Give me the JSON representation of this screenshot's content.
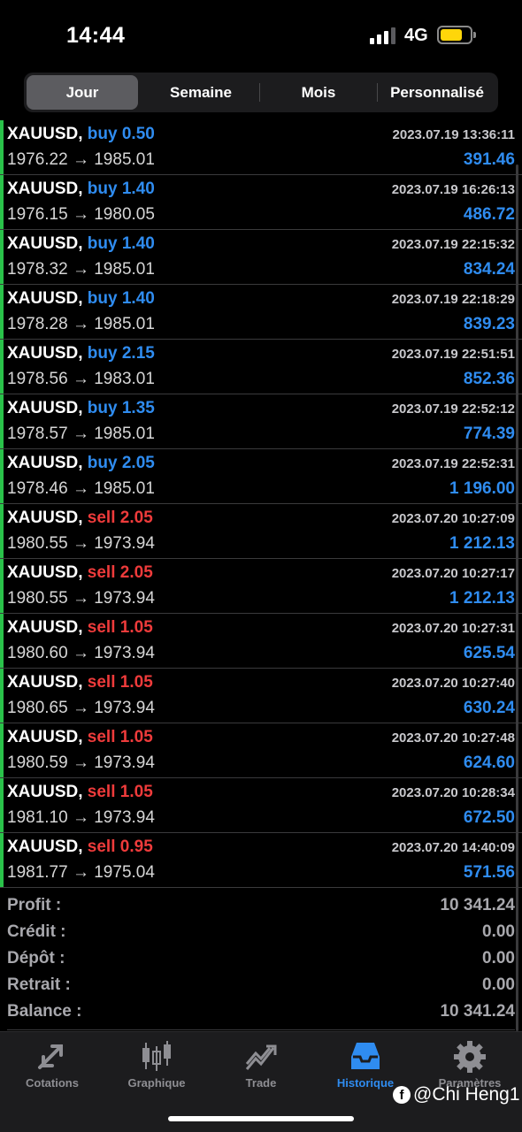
{
  "status_bar": {
    "time": "14:44",
    "network": "4G"
  },
  "periods": [
    {
      "label": "Jour",
      "active": true
    },
    {
      "label": "Semaine",
      "active": false
    },
    {
      "label": "Mois",
      "active": false
    },
    {
      "label": "Personnalisé",
      "active": false
    }
  ],
  "trades": [
    {
      "symbol": "XAUUSD,",
      "side": "buy",
      "volume": "0.50",
      "datetime": "2023.07.19 13:36:11",
      "prices": "1976.22 → 1985.01",
      "profit": "391.46"
    },
    {
      "symbol": "XAUUSD,",
      "side": "buy",
      "volume": "1.40",
      "datetime": "2023.07.19 16:26:13",
      "prices": "1976.15 → 1980.05",
      "profit": "486.72"
    },
    {
      "symbol": "XAUUSD,",
      "side": "buy",
      "volume": "1.40",
      "datetime": "2023.07.19 22:15:32",
      "prices": "1978.32 → 1985.01",
      "profit": "834.24"
    },
    {
      "symbol": "XAUUSD,",
      "side": "buy",
      "volume": "1.40",
      "datetime": "2023.07.19 22:18:29",
      "prices": "1978.28 → 1985.01",
      "profit": "839.23"
    },
    {
      "symbol": "XAUUSD,",
      "side": "buy",
      "volume": "2.15",
      "datetime": "2023.07.19 22:51:51",
      "prices": "1978.56 → 1983.01",
      "profit": "852.36"
    },
    {
      "symbol": "XAUUSD,",
      "side": "buy",
      "volume": "1.35",
      "datetime": "2023.07.19 22:52:12",
      "prices": "1978.57 → 1985.01",
      "profit": "774.39"
    },
    {
      "symbol": "XAUUSD,",
      "side": "buy",
      "volume": "2.05",
      "datetime": "2023.07.19 22:52:31",
      "prices": "1978.46 → 1985.01",
      "profit": "1 196.00"
    },
    {
      "symbol": "XAUUSD,",
      "side": "sell",
      "volume": "2.05",
      "datetime": "2023.07.20 10:27:09",
      "prices": "1980.55 → 1973.94",
      "profit": "1 212.13"
    },
    {
      "symbol": "XAUUSD,",
      "side": "sell",
      "volume": "2.05",
      "datetime": "2023.07.20 10:27:17",
      "prices": "1980.55 → 1973.94",
      "profit": "1 212.13"
    },
    {
      "symbol": "XAUUSD,",
      "side": "sell",
      "volume": "1.05",
      "datetime": "2023.07.20 10:27:31",
      "prices": "1980.60 → 1973.94",
      "profit": "625.54"
    },
    {
      "symbol": "XAUUSD,",
      "side": "sell",
      "volume": "1.05",
      "datetime": "2023.07.20 10:27:40",
      "prices": "1980.65 → 1973.94",
      "profit": "630.24"
    },
    {
      "symbol": "XAUUSD,",
      "side": "sell",
      "volume": "1.05",
      "datetime": "2023.07.20 10:27:48",
      "prices": "1980.59 → 1973.94",
      "profit": "624.60"
    },
    {
      "symbol": "XAUUSD,",
      "side": "sell",
      "volume": "1.05",
      "datetime": "2023.07.20 10:28:34",
      "prices": "1981.10 → 1973.94",
      "profit": "672.50"
    },
    {
      "symbol": "XAUUSD,",
      "side": "sell",
      "volume": "0.95",
      "datetime": "2023.07.20 14:40:09",
      "prices": "1981.77 → 1975.04",
      "profit": "571.56"
    }
  ],
  "summary": [
    {
      "label": "Profit :",
      "value": "10 341.24"
    },
    {
      "label": "Crédit :",
      "value": "0.00"
    },
    {
      "label": "Dépôt :",
      "value": "0.00"
    },
    {
      "label": "Retrait :",
      "value": "0.00"
    },
    {
      "label": "Balance :",
      "value": "10 341.24"
    }
  ],
  "tabs": [
    {
      "label": "Cotations",
      "icon": "quotes-arrows-icon",
      "active": false
    },
    {
      "label": "Graphique",
      "icon": "candlestick-chart-icon",
      "active": false
    },
    {
      "label": "Trade",
      "icon": "trade-trend-icon",
      "active": false
    },
    {
      "label": "Historique",
      "icon": "inbox-tray-icon",
      "active": true
    },
    {
      "label": "Paramètres",
      "icon": "gear-icon",
      "active": false
    }
  ],
  "watermark": "@Chi Heng1",
  "colors": {
    "buy": "#2f8cf0",
    "sell": "#ee3b3b",
    "profit": "#2f8cf0",
    "row_marker": "#2ac24a",
    "active_tab": "#2f8cf0"
  }
}
